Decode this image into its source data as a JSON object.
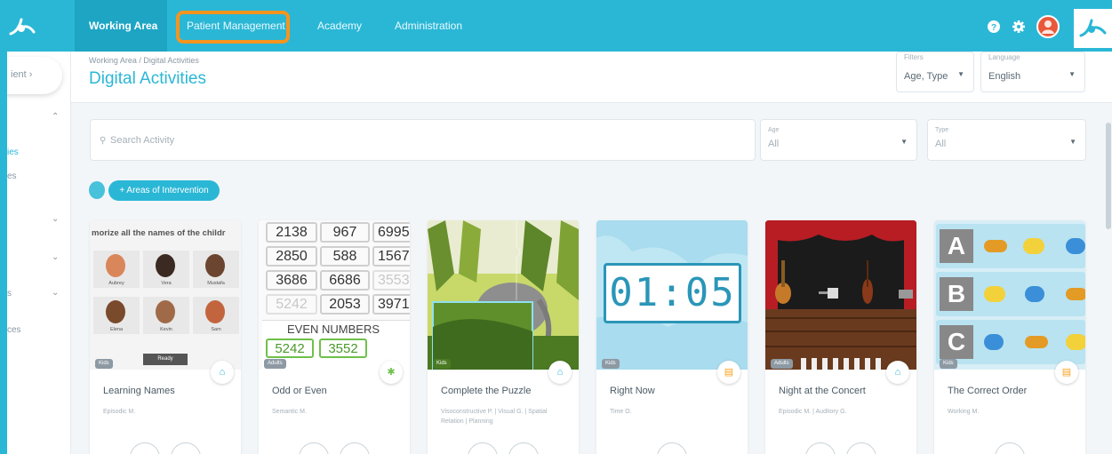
{
  "nav": {
    "items": [
      "Working Area",
      "Patient Management",
      "Academy",
      "Administration"
    ],
    "help_icon": "help-circle-icon",
    "settings_icon": "gear-icon"
  },
  "sidebar": {
    "patient_button": "ient ›",
    "fragments": [
      "ies",
      "es",
      "s",
      "ces"
    ]
  },
  "page": {
    "breadcrumb": "Working Area / Digital Activities",
    "title": "Digital Activities",
    "filters_label": "Filters",
    "filters_value": "Age, Type",
    "language_label": "Language",
    "language_value": "English"
  },
  "search": {
    "placeholder": "Search Activity",
    "age_label": "Age",
    "age_value": "All",
    "type_label": "Type",
    "type_value": "All",
    "areas_button": "+ Areas of Intervention"
  },
  "cards": [
    {
      "title": "Learning Names",
      "subtitle": "Episodic M.",
      "tag": "Kids",
      "thumb_header": "morize all the names of the childr",
      "names": [
        "Aubrey",
        "Vera",
        "Mustafa",
        "Elena",
        "Kevin",
        "Sam"
      ],
      "button_text": "Ready"
    },
    {
      "title": "Odd or Even",
      "subtitle": "Semantic M.",
      "tag": "Adults",
      "numbers": [
        "2138",
        "967",
        "6995",
        "2850",
        "588",
        "1567",
        "3686",
        "6686",
        "3553",
        "5242",
        "2053",
        "3971"
      ],
      "panel_label": "EVEN NUMBERS",
      "panel_numbers": [
        "5242",
        "3552"
      ]
    },
    {
      "title": "Complete the Puzzle",
      "subtitle": "Visoconstructive P. | Visual G. | Spatial Relation | Planning",
      "tag": "Kids"
    },
    {
      "title": "Right Now",
      "subtitle": "Time O.",
      "tag": "Kids",
      "clock": "01:05"
    },
    {
      "title": "Night at the Concert",
      "subtitle": "Episodic M. | Auditory G.",
      "tag": "Adults"
    },
    {
      "title": "The Correct Order",
      "subtitle": "Working M.",
      "tag": "Kids",
      "row_letters": [
        "A",
        "B",
        "C"
      ]
    }
  ],
  "colors": {
    "brand": "#2ab7d6",
    "highlight": "#f7941d",
    "avatar": "#e8593a"
  }
}
